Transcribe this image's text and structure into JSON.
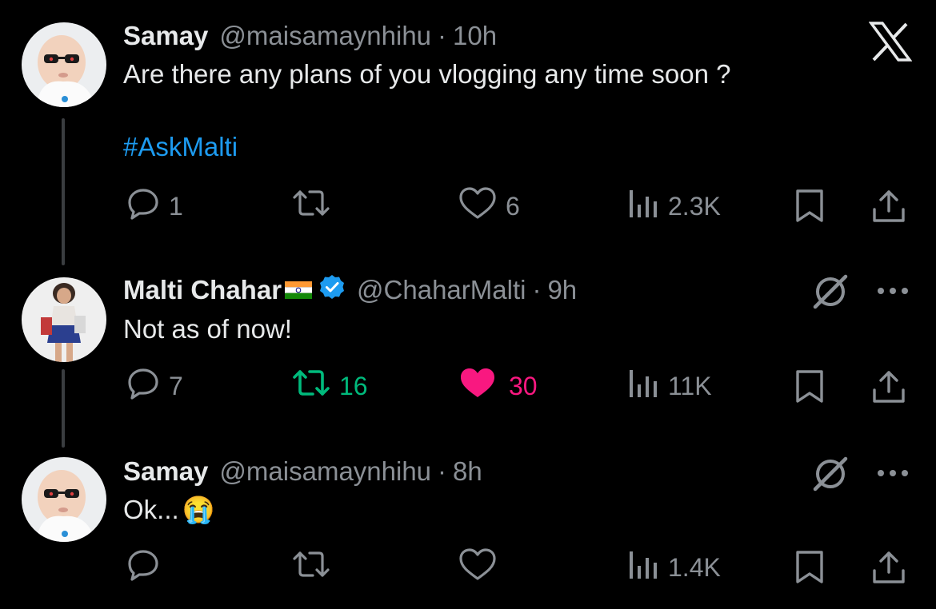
{
  "brand": {
    "logo_icon": "x-logo-icon"
  },
  "colors": {
    "background": "#000000",
    "text": "#e7e9ea",
    "muted": "#8b9096",
    "link": "#1d9bf0",
    "retweet_active": "#00ba7c",
    "like_active": "#f91880",
    "verified": "#1d9bf0"
  },
  "tweets": [
    {
      "name": "Samay",
      "handle": "@maisamaynhihu",
      "separator": "·",
      "time": "10h",
      "text": "Are there any plans of you vlogging any time soon ?",
      "hashtag": "#AskMalti",
      "replies": "1",
      "retweets": "",
      "likes": "6",
      "views": "2.3K",
      "liked": false,
      "retweeted": false
    },
    {
      "name": "Malti Chahar",
      "flag_icon": "india-flag-icon",
      "verified": true,
      "handle": "@ChaharMalti",
      "separator": "·",
      "time": "9h",
      "text": "Not as of now!",
      "replies": "7",
      "retweets": "16",
      "likes": "30",
      "views": "11K",
      "liked": true,
      "retweeted": true
    },
    {
      "name": "Samay",
      "handle": "@maisamaynhihu",
      "separator": "·",
      "time": "8h",
      "text": "Ok...",
      "emoji": "😭",
      "replies": "",
      "retweets": "",
      "likes": "",
      "views": "1.4K",
      "liked": false,
      "retweeted": false
    }
  ]
}
